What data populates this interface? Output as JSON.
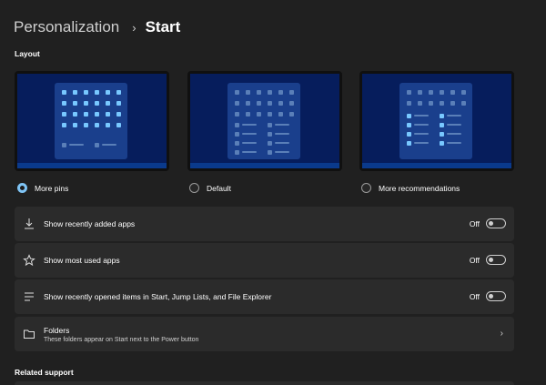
{
  "breadcrumb": {
    "parent": "Personalization",
    "separator": "›",
    "current": "Start"
  },
  "sections": {
    "layout": "Layout",
    "related_support": "Related support"
  },
  "layout_options": [
    {
      "label": "More pins",
      "selected": true
    },
    {
      "label": "Default",
      "selected": false
    },
    {
      "label": "More recommendations",
      "selected": false
    }
  ],
  "settings": [
    {
      "icon": "download-icon",
      "label": "Show recently added apps",
      "state": "Off"
    },
    {
      "icon": "star-icon",
      "label": "Show most used apps",
      "state": "Off"
    },
    {
      "icon": "list-icon",
      "label": "Show recently opened items in Start, Jump Lists, and File Explorer",
      "state": "Off"
    }
  ],
  "folders": {
    "icon": "folder-icon",
    "title": "Folders",
    "subtitle": "These folders appear on Start next to the Power button",
    "chevron": "›"
  },
  "colors": {
    "accent": "#7fc4f5",
    "card": "#2b2b2b",
    "background": "#202020",
    "preview": "#061d5c"
  }
}
